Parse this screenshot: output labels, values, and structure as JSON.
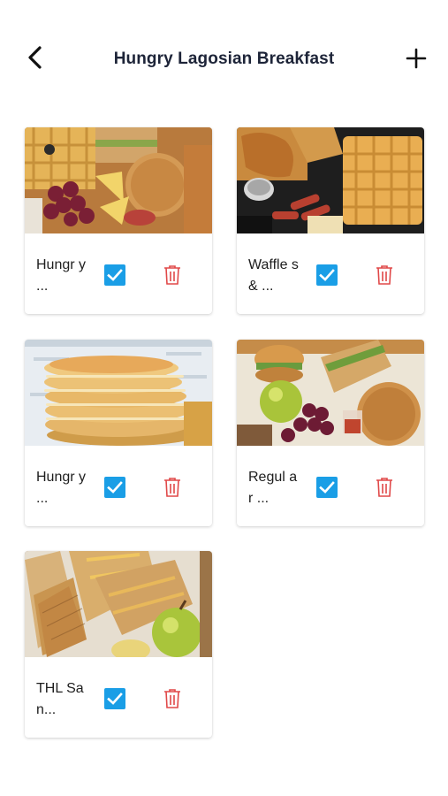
{
  "header": {
    "title": "Hungry Lagosian Breakfast",
    "back_icon": "chevron-left-icon",
    "add_icon": "plus-icon"
  },
  "colors": {
    "checkbox": "#1a9ee6",
    "delete_icon": "#e04848",
    "title": "#1d2438"
  },
  "items": [
    {
      "name": "Hungr y ...",
      "selected": true,
      "image": "breakfast platter with waffle, grapes, pancake and sandwich"
    },
    {
      "name": "Waffle s & ...",
      "selected": true,
      "image": "waffles with chicken wings and sausages"
    },
    {
      "name": "Hungr y ...",
      "selected": true,
      "image": "stack of pancakes"
    },
    {
      "name": "Regul ar ...",
      "selected": true,
      "image": "box with burger, apple, grapes, pancake and sandwich"
    },
    {
      "name": "THL San...",
      "selected": true,
      "image": "toasted sandwiches with an apple"
    }
  ]
}
